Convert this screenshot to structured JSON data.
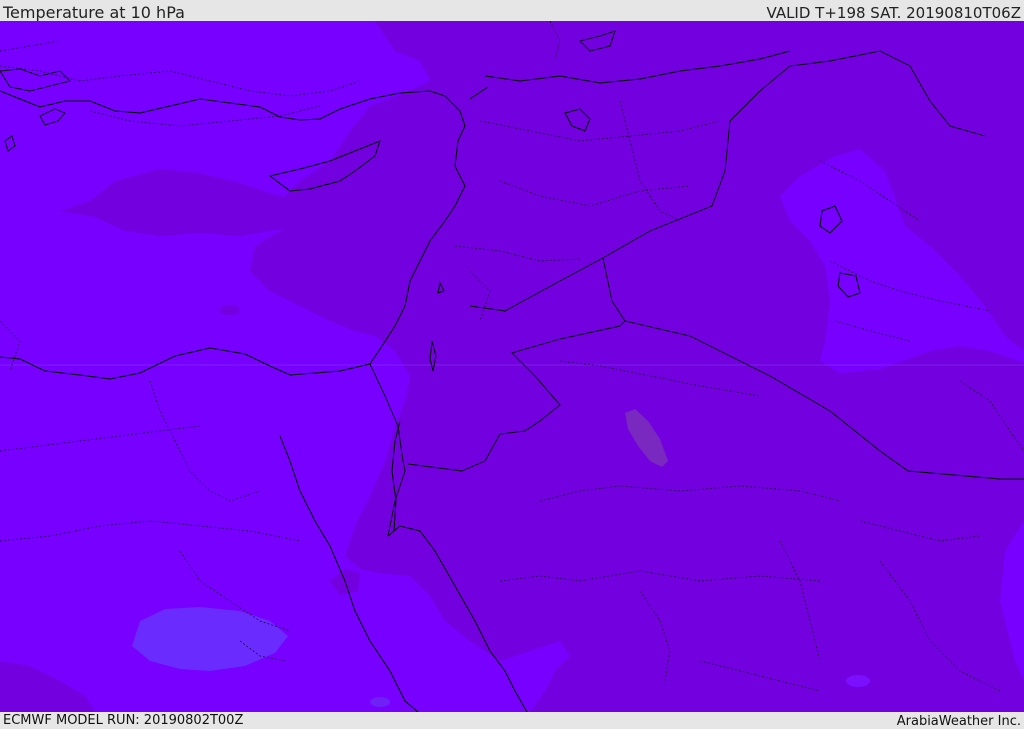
{
  "header": {
    "title": "Temperature at 10 hPa",
    "valid": "VALID T+198 SAT. 20190810T06Z"
  },
  "footer": {
    "model_run": "ECMWF MODEL RUN: 20190802T00Z",
    "credit": "ArabiaWeather Inc."
  },
  "map": {
    "region": "Eastern Mediterranean / Middle East",
    "colors": {
      "background_field": "#7700ff",
      "warmer_band": "#7300df",
      "warm_patch": "#7a2fbb",
      "cold_patch": "#6a2bff",
      "coastline": "#000000",
      "boundary": "#000000"
    }
  }
}
